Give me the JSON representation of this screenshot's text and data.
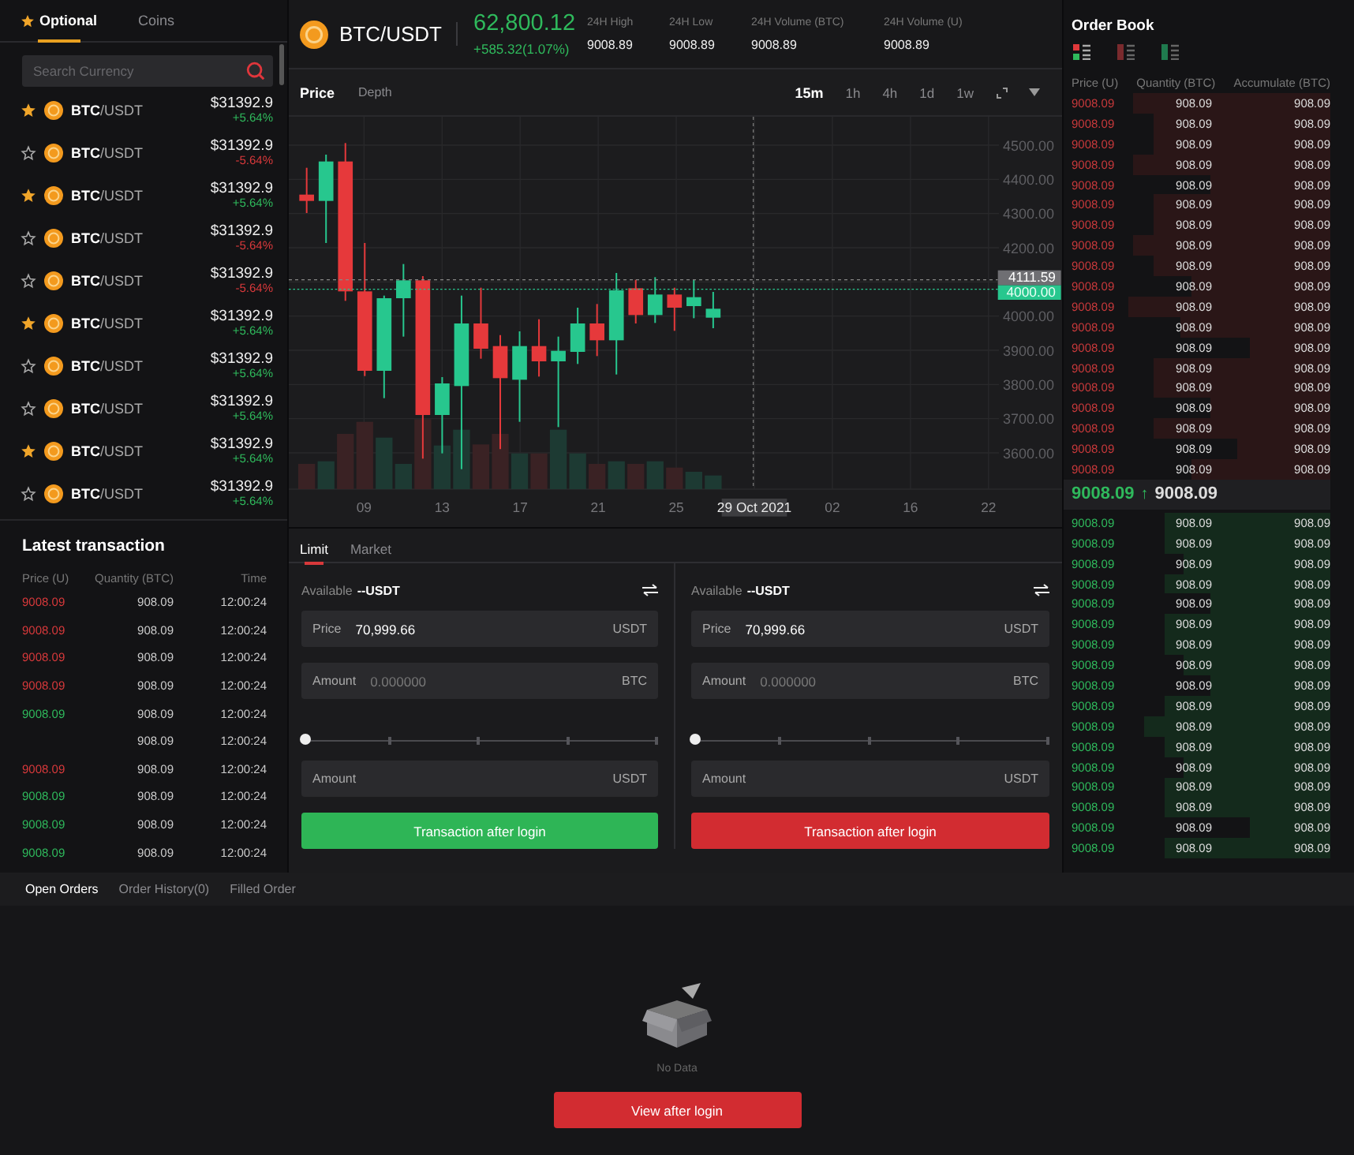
{
  "market_tabs": [
    {
      "label": "Optional",
      "selected": true
    },
    {
      "label": "Coins",
      "selected": false
    }
  ],
  "search": {
    "placeholder": "Search Currency"
  },
  "markets": [
    {
      "pair": "**BTC**/USDT",
      "price": "$31392.9",
      "change": "+5.64%",
      "color": "#2fb95c",
      "favorite": true
    },
    {
      "pair": "**BTC**/USDT",
      "price": "$31392.9",
      "change": "-5.64%",
      "color": "#d8393b",
      "favorite": false
    },
    {
      "pair": "**BTC**/USDT",
      "price": "$31392.9",
      "change": "+5.64%",
      "color": "#2fb95c",
      "favorite": true
    },
    {
      "pair": "**BTC**/USDT",
      "price": "$31392.9",
      "change": "-5.64%",
      "color": "#d8393b",
      "favorite": false
    },
    {
      "pair": "**BTC**/USDT",
      "price": "$31392.9",
      "change": "-5.64%",
      "color": "#d8393b",
      "favorite": false
    },
    {
      "pair": "**BTC**/USDT",
      "price": "$31392.9",
      "change": "+5.64%",
      "color": "#2fb95c",
      "favorite": true
    },
    {
      "pair": "**BTC**/USDT",
      "price": "$31392.9",
      "change": "+5.64%",
      "color": "#2fb95c",
      "favorite": false
    },
    {
      "pair": "**BTC**/USDT",
      "price": "$31392.9",
      "change": "+5.64%",
      "color": "#2fb95c",
      "favorite": false
    },
    {
      "pair": "**BTC**/USDT",
      "price": "$31392.9",
      "change": "+5.64%",
      "color": "#2fb95c",
      "favorite": true
    },
    {
      "pair": "**BTC**/USDT",
      "price": "$31392.9",
      "change": "+5.64%",
      "color": "#2fb95c",
      "favorite": false
    }
  ],
  "latest_transactions": {
    "title": "Latest transaction",
    "columns": [
      "Price (U)",
      "Quantity (BTC)",
      "Time"
    ],
    "rows": [
      {
        "price": "9008.09",
        "color": "#d8393b",
        "quantity": "908.09",
        "time": "12:00:24"
      },
      {
        "price": "9008.09",
        "color": "#d8393b",
        "quantity": "908.09",
        "time": "12:00:24"
      },
      {
        "price": "9008.09",
        "color": "#d8393b",
        "quantity": "908.09",
        "time": "12:00:24"
      },
      {
        "price": "9008.09",
        "color": "#d8393b",
        "quantity": "908.09",
        "time": "12:00:24"
      },
      {
        "price": "9008.09",
        "color": "#2fb95c",
        "quantity": "908.09",
        "time": "12:00:24"
      },
      {
        "quantity": "908.09",
        "time": "12:00:24"
      },
      {
        "price": "9008.09",
        "color": "#d8393b",
        "quantity": "908.09",
        "time": "12:00:24"
      },
      {
        "price": "9008.09",
        "color": "#2fb95c",
        "quantity": "908.09",
        "time": "12:00:24"
      },
      {
        "price": "9008.09",
        "color": "#2fb95c",
        "quantity": "908.09",
        "time": "12:00:24"
      },
      {
        "price": "9008.09",
        "color": "#2fb95c",
        "quantity": "908.09",
        "time": "12:00:24"
      }
    ]
  },
  "ticker": {
    "pair": "BTC/USDT",
    "price": "62,800.12",
    "change": "+585.32(1.07%)",
    "stats": [
      {
        "label": "24H High",
        "value": "9008.89"
      },
      {
        "label": "24H Low",
        "value": "9008.89"
      },
      {
        "label": "24H Volume (BTC)",
        "value": "9008.89"
      },
      {
        "label": "24H Volume (U)",
        "value": "9008.89"
      }
    ]
  },
  "chart_tabs": [
    {
      "label": "Price",
      "selected": true
    },
    {
      "label": "Depth",
      "selected": false
    }
  ],
  "intervals": [
    {
      "label": "15m",
      "selected": true
    },
    {
      "label": "1h",
      "selected": false
    },
    {
      "label": "4h",
      "selected": false
    },
    {
      "label": "1d",
      "selected": false
    },
    {
      "label": "1w",
      "selected": false
    }
  ],
  "chart": {
    "y_labels": [
      "4500.00",
      "4400.00",
      "4300.00",
      "4200.00",
      "4000.00",
      "3900.00",
      "3800.00",
      "3700.00",
      "3600.00"
    ],
    "x_labels": [
      {
        "label": "09",
        "highlighted": false
      },
      {
        "label": "13",
        "highlighted": false
      },
      {
        "label": "17",
        "highlighted": false
      },
      {
        "label": "21",
        "highlighted": false
      },
      {
        "label": "25",
        "highlighted": false
      },
      {
        "label": "29 Oct 2021",
        "highlighted": true
      },
      {
        "label": "02",
        "highlighted": false
      },
      {
        "label": "16",
        "highlighted": false
      },
      {
        "label": "22",
        "highlighted": false
      }
    ],
    "price_tags": [
      {
        "label": "4111.59",
        "kind": "crosshair"
      },
      {
        "label": "4000.00",
        "kind": "last"
      }
    ]
  },
  "order_tabs": [
    {
      "label": "Limit",
      "selected": true
    },
    {
      "label": "Market",
      "selected": false
    }
  ],
  "order_forms": [
    {
      "kind": "buy",
      "available_label": "Available",
      "available_value": "--USDT",
      "price_label": "Price",
      "price_value": "70,999.66",
      "price_unit": "USDT",
      "amount_label": "Amount",
      "amount_placeholder": "0.000000",
      "amount_unit": "BTC",
      "level": 0,
      "total_label": "Amount",
      "total_unit": "USDT",
      "button": "Transaction after login"
    },
    {
      "kind": "sell",
      "available_label": "Available",
      "available_value": "--USDT",
      "price_label": "Price",
      "price_value": "70,999.66",
      "price_unit": "USDT",
      "amount_label": "Amount",
      "amount_placeholder": "0.000000",
      "amount_unit": "BTC",
      "level": 0,
      "total_label": "Amount",
      "total_unit": "USDT",
      "button": "Transaction after login"
    }
  ],
  "order_book": {
    "title": "Order Book",
    "views": [
      {
        "kind": "both"
      },
      {
        "kind": "asks"
      },
      {
        "kind": "bids"
      }
    ],
    "columns": [
      "Price (U)",
      "Quantity (BTC)",
      "Accumulate (BTC)"
    ],
    "asks": [
      {
        "price": "9008.09",
        "quantity": "908.09",
        "total": "908.09"
      },
      {
        "price": "9008.09",
        "quantity": "908.09",
        "total": "908.09"
      },
      {
        "price": "9008.09",
        "quantity": "908.09",
        "total": "908.09"
      },
      {
        "price": "9008.09",
        "quantity": "908.09",
        "total": "908.09"
      },
      {
        "price": "9008.09",
        "quantity": "908.09",
        "total": "908.09"
      },
      {
        "price": "9008.09",
        "quantity": "908.09",
        "total": "908.09"
      },
      {
        "price": "9008.09",
        "quantity": "908.09",
        "total": "908.09"
      },
      {
        "price": "9008.09",
        "quantity": "908.09",
        "total": "908.09"
      },
      {
        "price": "9008.09",
        "quantity": "908.09",
        "total": "908.09"
      },
      {
        "price": "9008.09",
        "quantity": "908.09",
        "total": "908.09"
      },
      {
        "price": "9008.09",
        "quantity": "908.09",
        "total": "908.09"
      },
      {
        "price": "9008.09",
        "quantity": "908.09",
        "total": "908.09"
      },
      {
        "price": "9008.09",
        "quantity": "908.09",
        "total": "908.09"
      },
      {
        "price": "9008.09",
        "quantity": "908.09",
        "total": "908.09"
      },
      {
        "price": "9008.09",
        "quantity": "908.09",
        "total": "908.09"
      },
      {
        "price": "9008.09",
        "quantity": "908.09",
        "total": "908.09"
      },
      {
        "price": "9008.09",
        "quantity": "908.09",
        "total": "908.09"
      },
      {
        "price": "9008.09",
        "quantity": "908.09",
        "total": "908.09"
      },
      {
        "price": "9008.09",
        "quantity": "908.09",
        "total": "908.09"
      }
    ],
    "last": {
      "price": "9008.09",
      "arrow": "↑",
      "value": "9008.09"
    },
    "bids": [
      {
        "price": "9008.09",
        "quantity": "908.09",
        "total": "908.09"
      },
      {
        "price": "9008.09",
        "quantity": "908.09",
        "total": "908.09"
      },
      {
        "price": "9008.09",
        "quantity": "908.09",
        "total": "908.09"
      },
      {
        "price": "9008.09",
        "quantity": "908.09",
        "total": "908.09"
      },
      {
        "price": "9008.09",
        "quantity": "908.09",
        "total": "908.09"
      },
      {
        "price": "9008.09",
        "quantity": "908.09",
        "total": "908.09"
      },
      {
        "price": "9008.09",
        "quantity": "908.09",
        "total": "908.09"
      },
      {
        "price": "9008.09",
        "quantity": "908.09",
        "total": "908.09"
      },
      {
        "price": "9008.09",
        "quantity": "908.09",
        "total": "908.09"
      },
      {
        "price": "9008.09",
        "quantity": "908.09",
        "total": "908.09"
      },
      {
        "price": "9008.09",
        "quantity": "908.09",
        "total": "908.09"
      },
      {
        "price": "9008.09",
        "quantity": "908.09",
        "total": "908.09"
      },
      {
        "price": "9008.09",
        "quantity": "908.09",
        "total": "908.09"
      },
      {
        "price": "9008.09",
        "quantity": "908.09",
        "total": "908.09"
      },
      {
        "price": "9008.09",
        "quantity": "908.09",
        "total": "908.09"
      },
      {
        "price": "9008.09",
        "quantity": "908.09",
        "total": "908.09"
      },
      {
        "price": "9008.09",
        "quantity": "908.09",
        "total": "908.09"
      }
    ]
  },
  "orders": {
    "tabs": [
      {
        "label": "Open Orders",
        "selected": true
      },
      {
        "label": "Order History(0)",
        "selected": false
      },
      {
        "label": "Filled Order",
        "selected": false
      }
    ],
    "empty_text": "No Data",
    "button": "View after login"
  }
}
